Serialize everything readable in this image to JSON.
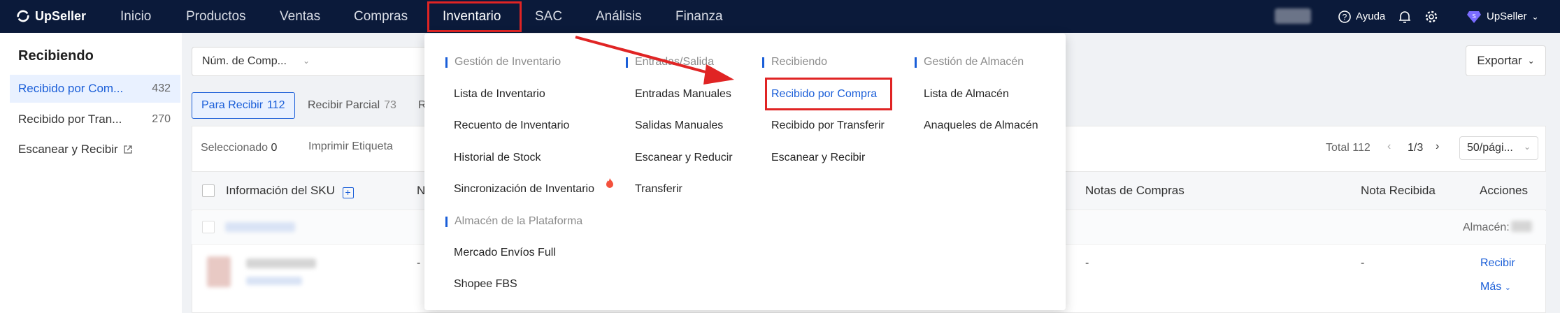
{
  "app": {
    "logo_text": "UpSeller"
  },
  "topnav": {
    "items": [
      "Inicio",
      "Productos",
      "Ventas",
      "Compras",
      "Inventario",
      "SAC",
      "Análisis",
      "Finanza"
    ],
    "active": "Inventario",
    "help_label": "Ayuda",
    "account_label": "UpSeller"
  },
  "sidebar": {
    "title": "Recibiendo",
    "items": [
      {
        "label": "Recibido por Com...",
        "count": "432"
      },
      {
        "label": "Recibido por Tran...",
        "count": "270"
      },
      {
        "label": "Escanear y Recibir",
        "count": ""
      }
    ]
  },
  "filter": {
    "select_label": "Núm. de Comp...",
    "export_label": "Exportar"
  },
  "tabs": [
    {
      "label": "Para Recibir",
      "count": "112"
    },
    {
      "label": "Recibir Parcial",
      "count": "73"
    },
    {
      "label": "R",
      "count": ""
    }
  ],
  "toolbar": {
    "selected_label": "Seleccionado",
    "selected_count": "0",
    "print_label": "Imprimir Etiqueta",
    "total_label": "Total 112",
    "page": "1/3",
    "page_size": "50/pági..."
  },
  "table": {
    "headers": [
      "Información del SKU",
      "N",
      "Notas de Compras",
      "Nota Recibida",
      "Acciones"
    ],
    "group_label": "Almacén:",
    "row": {
      "col_n": "-",
      "notas": "-",
      "nota_recibida": "-",
      "action_primary": "Recibir",
      "action_more": "Más"
    }
  },
  "mega_menu": {
    "columns": [
      {
        "heading": "Gestión de Inventario",
        "items": [
          "Lista de Inventario",
          "Recuento de Inventario",
          "Historial de Stock",
          "Sincronización de Inventario"
        ],
        "heading2": "Almacén de la Plataforma",
        "items2": [
          "Mercado Envíos Full",
          "Shopee FBS"
        ]
      },
      {
        "heading": "Entradas/Salida",
        "items": [
          "Entradas Manuales",
          "Salidas Manuales",
          "Escanear y Reducir",
          "Transferir"
        ]
      },
      {
        "heading": "Recibiendo",
        "items": [
          "Recibido por Compra",
          "Recibido por Transferir",
          "Escanear y Recibir"
        ],
        "selected": "Recibido por Compra"
      },
      {
        "heading": "Gestión de Almacén",
        "items": [
          "Lista de Almacén",
          "Anaqueles de Almacén"
        ]
      }
    ]
  },
  "colors": {
    "nav_bg": "#0b1a3a",
    "accent": "#1a5ed8",
    "highlight": "#e02424"
  }
}
